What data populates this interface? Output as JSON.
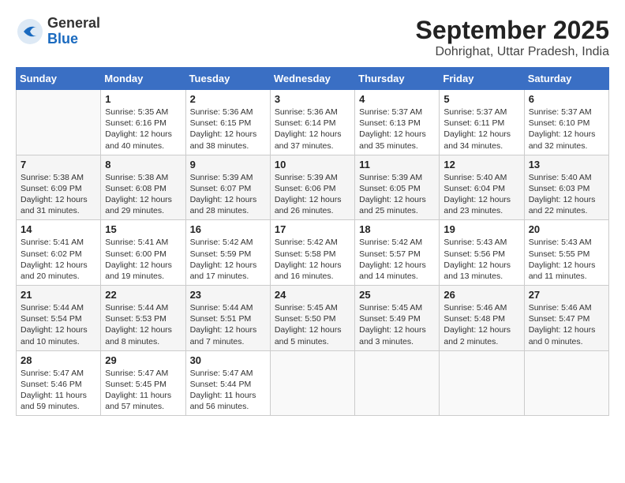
{
  "logo": {
    "general": "General",
    "blue": "Blue"
  },
  "header": {
    "month": "September 2025",
    "location": "Dohrighat, Uttar Pradesh, India"
  },
  "days_of_week": [
    "Sunday",
    "Monday",
    "Tuesday",
    "Wednesday",
    "Thursday",
    "Friday",
    "Saturday"
  ],
  "weeks": [
    [
      {
        "day": "",
        "info": ""
      },
      {
        "day": "1",
        "info": "Sunrise: 5:35 AM\nSunset: 6:16 PM\nDaylight: 12 hours and 40 minutes."
      },
      {
        "day": "2",
        "info": "Sunrise: 5:36 AM\nSunset: 6:15 PM\nDaylight: 12 hours and 38 minutes."
      },
      {
        "day": "3",
        "info": "Sunrise: 5:36 AM\nSunset: 6:14 PM\nDaylight: 12 hours and 37 minutes."
      },
      {
        "day": "4",
        "info": "Sunrise: 5:37 AM\nSunset: 6:13 PM\nDaylight: 12 hours and 35 minutes."
      },
      {
        "day": "5",
        "info": "Sunrise: 5:37 AM\nSunset: 6:11 PM\nDaylight: 12 hours and 34 minutes."
      },
      {
        "day": "6",
        "info": "Sunrise: 5:37 AM\nSunset: 6:10 PM\nDaylight: 12 hours and 32 minutes."
      }
    ],
    [
      {
        "day": "7",
        "info": "Sunrise: 5:38 AM\nSunset: 6:09 PM\nDaylight: 12 hours and 31 minutes."
      },
      {
        "day": "8",
        "info": "Sunrise: 5:38 AM\nSunset: 6:08 PM\nDaylight: 12 hours and 29 minutes."
      },
      {
        "day": "9",
        "info": "Sunrise: 5:39 AM\nSunset: 6:07 PM\nDaylight: 12 hours and 28 minutes."
      },
      {
        "day": "10",
        "info": "Sunrise: 5:39 AM\nSunset: 6:06 PM\nDaylight: 12 hours and 26 minutes."
      },
      {
        "day": "11",
        "info": "Sunrise: 5:39 AM\nSunset: 6:05 PM\nDaylight: 12 hours and 25 minutes."
      },
      {
        "day": "12",
        "info": "Sunrise: 5:40 AM\nSunset: 6:04 PM\nDaylight: 12 hours and 23 minutes."
      },
      {
        "day": "13",
        "info": "Sunrise: 5:40 AM\nSunset: 6:03 PM\nDaylight: 12 hours and 22 minutes."
      }
    ],
    [
      {
        "day": "14",
        "info": "Sunrise: 5:41 AM\nSunset: 6:02 PM\nDaylight: 12 hours and 20 minutes."
      },
      {
        "day": "15",
        "info": "Sunrise: 5:41 AM\nSunset: 6:00 PM\nDaylight: 12 hours and 19 minutes."
      },
      {
        "day": "16",
        "info": "Sunrise: 5:42 AM\nSunset: 5:59 PM\nDaylight: 12 hours and 17 minutes."
      },
      {
        "day": "17",
        "info": "Sunrise: 5:42 AM\nSunset: 5:58 PM\nDaylight: 12 hours and 16 minutes."
      },
      {
        "day": "18",
        "info": "Sunrise: 5:42 AM\nSunset: 5:57 PM\nDaylight: 12 hours and 14 minutes."
      },
      {
        "day": "19",
        "info": "Sunrise: 5:43 AM\nSunset: 5:56 PM\nDaylight: 12 hours and 13 minutes."
      },
      {
        "day": "20",
        "info": "Sunrise: 5:43 AM\nSunset: 5:55 PM\nDaylight: 12 hours and 11 minutes."
      }
    ],
    [
      {
        "day": "21",
        "info": "Sunrise: 5:44 AM\nSunset: 5:54 PM\nDaylight: 12 hours and 10 minutes."
      },
      {
        "day": "22",
        "info": "Sunrise: 5:44 AM\nSunset: 5:53 PM\nDaylight: 12 hours and 8 minutes."
      },
      {
        "day": "23",
        "info": "Sunrise: 5:44 AM\nSunset: 5:51 PM\nDaylight: 12 hours and 7 minutes."
      },
      {
        "day": "24",
        "info": "Sunrise: 5:45 AM\nSunset: 5:50 PM\nDaylight: 12 hours and 5 minutes."
      },
      {
        "day": "25",
        "info": "Sunrise: 5:45 AM\nSunset: 5:49 PM\nDaylight: 12 hours and 3 minutes."
      },
      {
        "day": "26",
        "info": "Sunrise: 5:46 AM\nSunset: 5:48 PM\nDaylight: 12 hours and 2 minutes."
      },
      {
        "day": "27",
        "info": "Sunrise: 5:46 AM\nSunset: 5:47 PM\nDaylight: 12 hours and 0 minutes."
      }
    ],
    [
      {
        "day": "28",
        "info": "Sunrise: 5:47 AM\nSunset: 5:46 PM\nDaylight: 11 hours and 59 minutes."
      },
      {
        "day": "29",
        "info": "Sunrise: 5:47 AM\nSunset: 5:45 PM\nDaylight: 11 hours and 57 minutes."
      },
      {
        "day": "30",
        "info": "Sunrise: 5:47 AM\nSunset: 5:44 PM\nDaylight: 11 hours and 56 minutes."
      },
      {
        "day": "",
        "info": ""
      },
      {
        "day": "",
        "info": ""
      },
      {
        "day": "",
        "info": ""
      },
      {
        "day": "",
        "info": ""
      }
    ]
  ]
}
